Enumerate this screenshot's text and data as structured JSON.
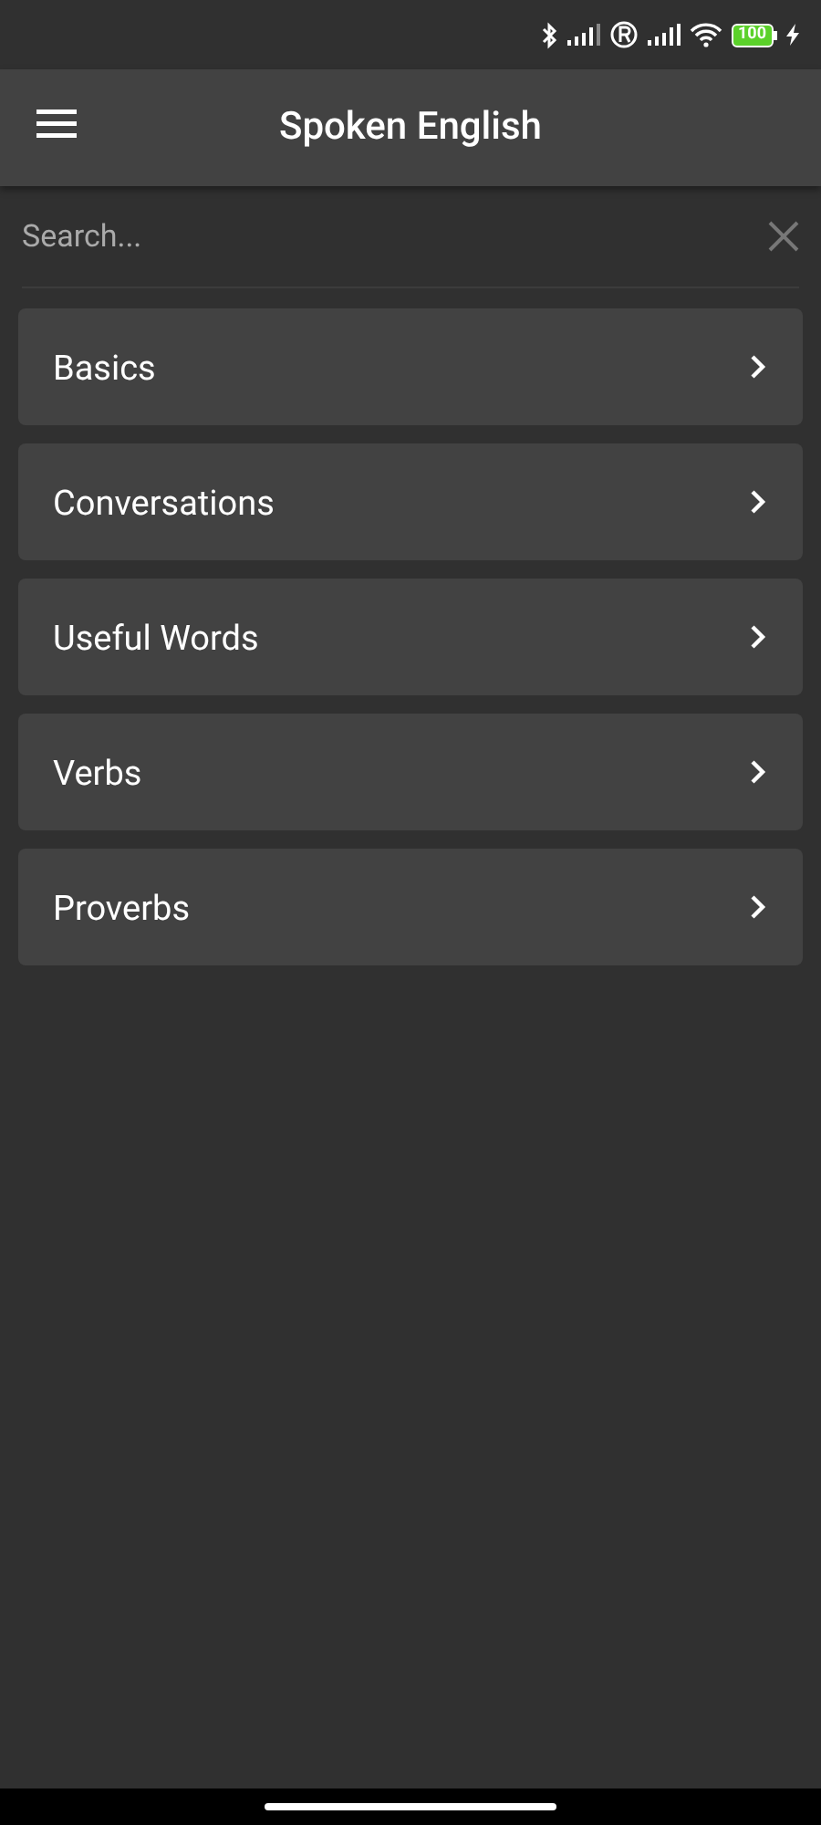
{
  "status_bar": {
    "battery": "100"
  },
  "app_bar": {
    "title": "Spoken English"
  },
  "search": {
    "placeholder": "Search..."
  },
  "items": [
    {
      "label": "Basics"
    },
    {
      "label": "Conversations"
    },
    {
      "label": "Useful Words"
    },
    {
      "label": "Verbs"
    },
    {
      "label": "Proverbs"
    }
  ]
}
